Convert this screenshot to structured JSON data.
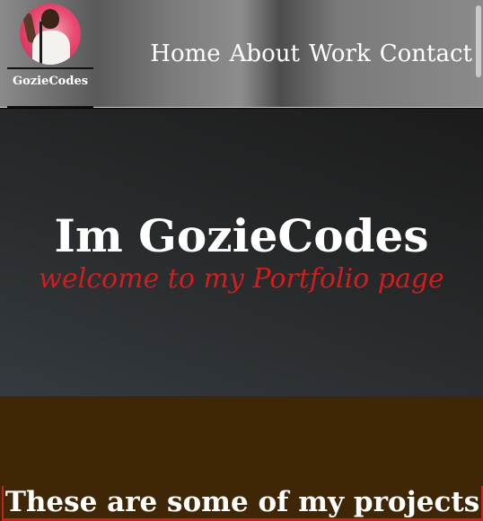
{
  "header": {
    "brand_name": "GozieCodes",
    "nav": [
      {
        "label": "Home"
      },
      {
        "label": "About"
      },
      {
        "label": "Work"
      },
      {
        "label": "Contact"
      }
    ]
  },
  "hero": {
    "title": "Im GozieCodes",
    "subtitle": "welcome to my Portfolio page"
  },
  "projects": {
    "heading": "These are some of my projects"
  },
  "colors": {
    "accent_red": "#d41c1c",
    "projects_bg": "#3e2607",
    "header_gray": "#7a7a7a",
    "hero_dark": "#262829"
  }
}
